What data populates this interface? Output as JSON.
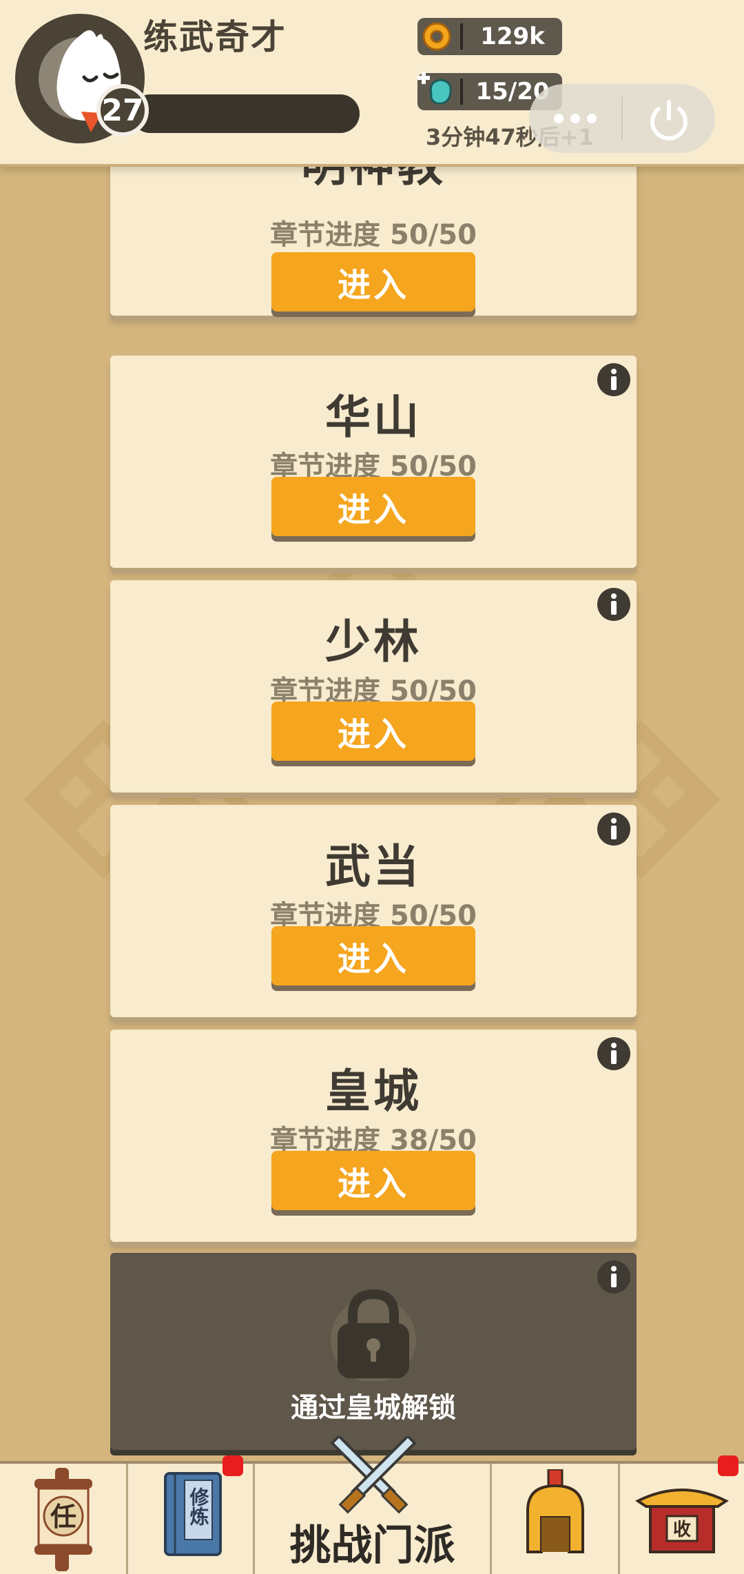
{
  "header": {
    "player_name": "练武奇才",
    "level": "27",
    "coins": "129k",
    "stamina": "15/20",
    "stamina_timer": "3分钟47秒后+1"
  },
  "cards": [
    {
      "title": "明神教",
      "progress": "章节进度 50/50",
      "button": "进入"
    },
    {
      "title": "华山",
      "progress": "章节进度 50/50",
      "button": "进入"
    },
    {
      "title": "少林",
      "progress": "章节进度 50/50",
      "button": "进入"
    },
    {
      "title": "武当",
      "progress": "章节进度 50/50",
      "button": "进入"
    },
    {
      "title": "皇城",
      "progress": "章节进度 38/50",
      "button": "进入"
    }
  ],
  "locked_card": {
    "text": "通过皇城解锁"
  },
  "bottom_nav": {
    "quest_glyph": "任",
    "train_glyph": "修炼",
    "main_label": "挑战门派",
    "shop_glyph": "收"
  },
  "colors": {
    "background": "#d4b57d",
    "card": "#f8ebce",
    "button": "#f5a51e",
    "locked": "#5e574a",
    "notification": "#e81d1d"
  }
}
